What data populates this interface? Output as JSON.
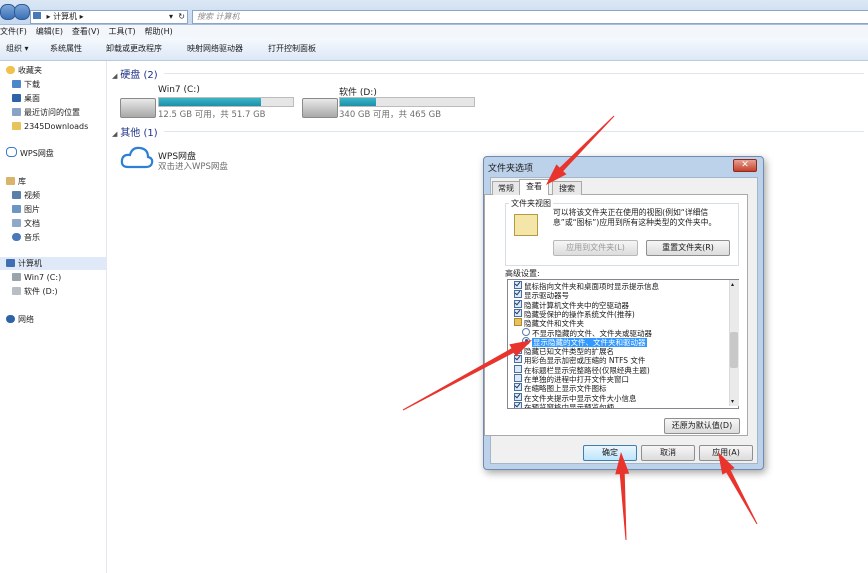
{
  "window": {
    "breadcrumb": "计算机",
    "search_placeholder": "搜索 计算机"
  },
  "menubar": [
    "文件(F)",
    "编辑(E)",
    "查看(V)",
    "工具(T)",
    "帮助(H)"
  ],
  "toolbar": [
    "组织 ▾",
    "系统属性",
    "卸载或更改程序",
    "映射网络驱动器",
    "打开控制面板"
  ],
  "sidebar": {
    "favorites": "收藏夹",
    "fav_items": [
      "下载",
      "桌面",
      "最近访问的位置",
      "2345Downloads"
    ],
    "wps": "WPS网盘",
    "library": "库",
    "lib_items": [
      "视频",
      "图片",
      "文档",
      "音乐"
    ],
    "computer": "计算机",
    "computer_items": [
      "Win7 (C:)",
      "软件 (D:)"
    ],
    "network": "网络"
  },
  "content": {
    "hard_disks_header": "硬盘 (2)",
    "drives": [
      {
        "name": "Win7 (C:)",
        "info": "12.5 GB 可用，共 51.7 GB",
        "used_fraction": 0.76
      },
      {
        "name": "软件 (D:)",
        "info": "340 GB 可用，共 465 GB",
        "used_fraction": 0.27
      }
    ],
    "other_header": "其他 (1)",
    "wps_name": "WPS网盘",
    "wps_desc": "双击进入WPS网盘"
  },
  "dialog": {
    "title": "文件夹选项",
    "close": "✕",
    "tabs": [
      "常规",
      "查看",
      "搜索"
    ],
    "folder_views_label": "文件夹视图",
    "folder_views_desc": "可以将该文件夹正在使用的视图(例如“详细信息”或“图标”)应用到所有这种类型的文件夹中。",
    "apply_to_folders": "应用到文件夹(L)",
    "reset_folders": "重置文件夹(R)",
    "advanced_label": "高级设置:",
    "advanced_items": [
      {
        "kind": "checkbox",
        "checked": true,
        "text": "鼠标指向文件夹和桌面项时显示提示信息"
      },
      {
        "kind": "checkbox",
        "checked": true,
        "text": "显示驱动器号"
      },
      {
        "kind": "checkbox",
        "checked": true,
        "text": "隐藏计算机文件夹中的空驱动器"
      },
      {
        "kind": "checkbox",
        "checked": true,
        "text": "隐藏受保护的操作系统文件(推荐)"
      },
      {
        "kind": "folder",
        "checked": false,
        "text": "隐藏文件和文件夹"
      },
      {
        "kind": "radio",
        "checked": false,
        "text": "不显示隐藏的文件、文件夹或驱动器"
      },
      {
        "kind": "radio",
        "checked": true,
        "text": "显示隐藏的文件、文件夹和驱动器"
      },
      {
        "kind": "checkbox",
        "checked": true,
        "text": "隐藏已知文件类型的扩展名"
      },
      {
        "kind": "checkbox",
        "checked": true,
        "text": "用彩色显示加密或压缩的 NTFS 文件"
      },
      {
        "kind": "checkbox",
        "checked": false,
        "text": "在标题栏显示完整路径(仅限经典主题)"
      },
      {
        "kind": "checkbox",
        "checked": false,
        "text": "在单独的进程中打开文件夹窗口"
      },
      {
        "kind": "checkbox",
        "checked": true,
        "text": "在缩略图上显示文件图标"
      },
      {
        "kind": "checkbox",
        "checked": true,
        "text": "在文件夹提示中显示文件大小信息"
      },
      {
        "kind": "checkbox",
        "checked": true,
        "text": "在预览窗格中显示预览句柄"
      }
    ],
    "restore_defaults": "还原为默认值(D)",
    "ok": "确定",
    "cancel": "取消",
    "apply": "应用(A)"
  },
  "colors": {
    "arrow": "#e8342c",
    "drive_fill": "#26a2b8",
    "selection": "#3399ff"
  }
}
